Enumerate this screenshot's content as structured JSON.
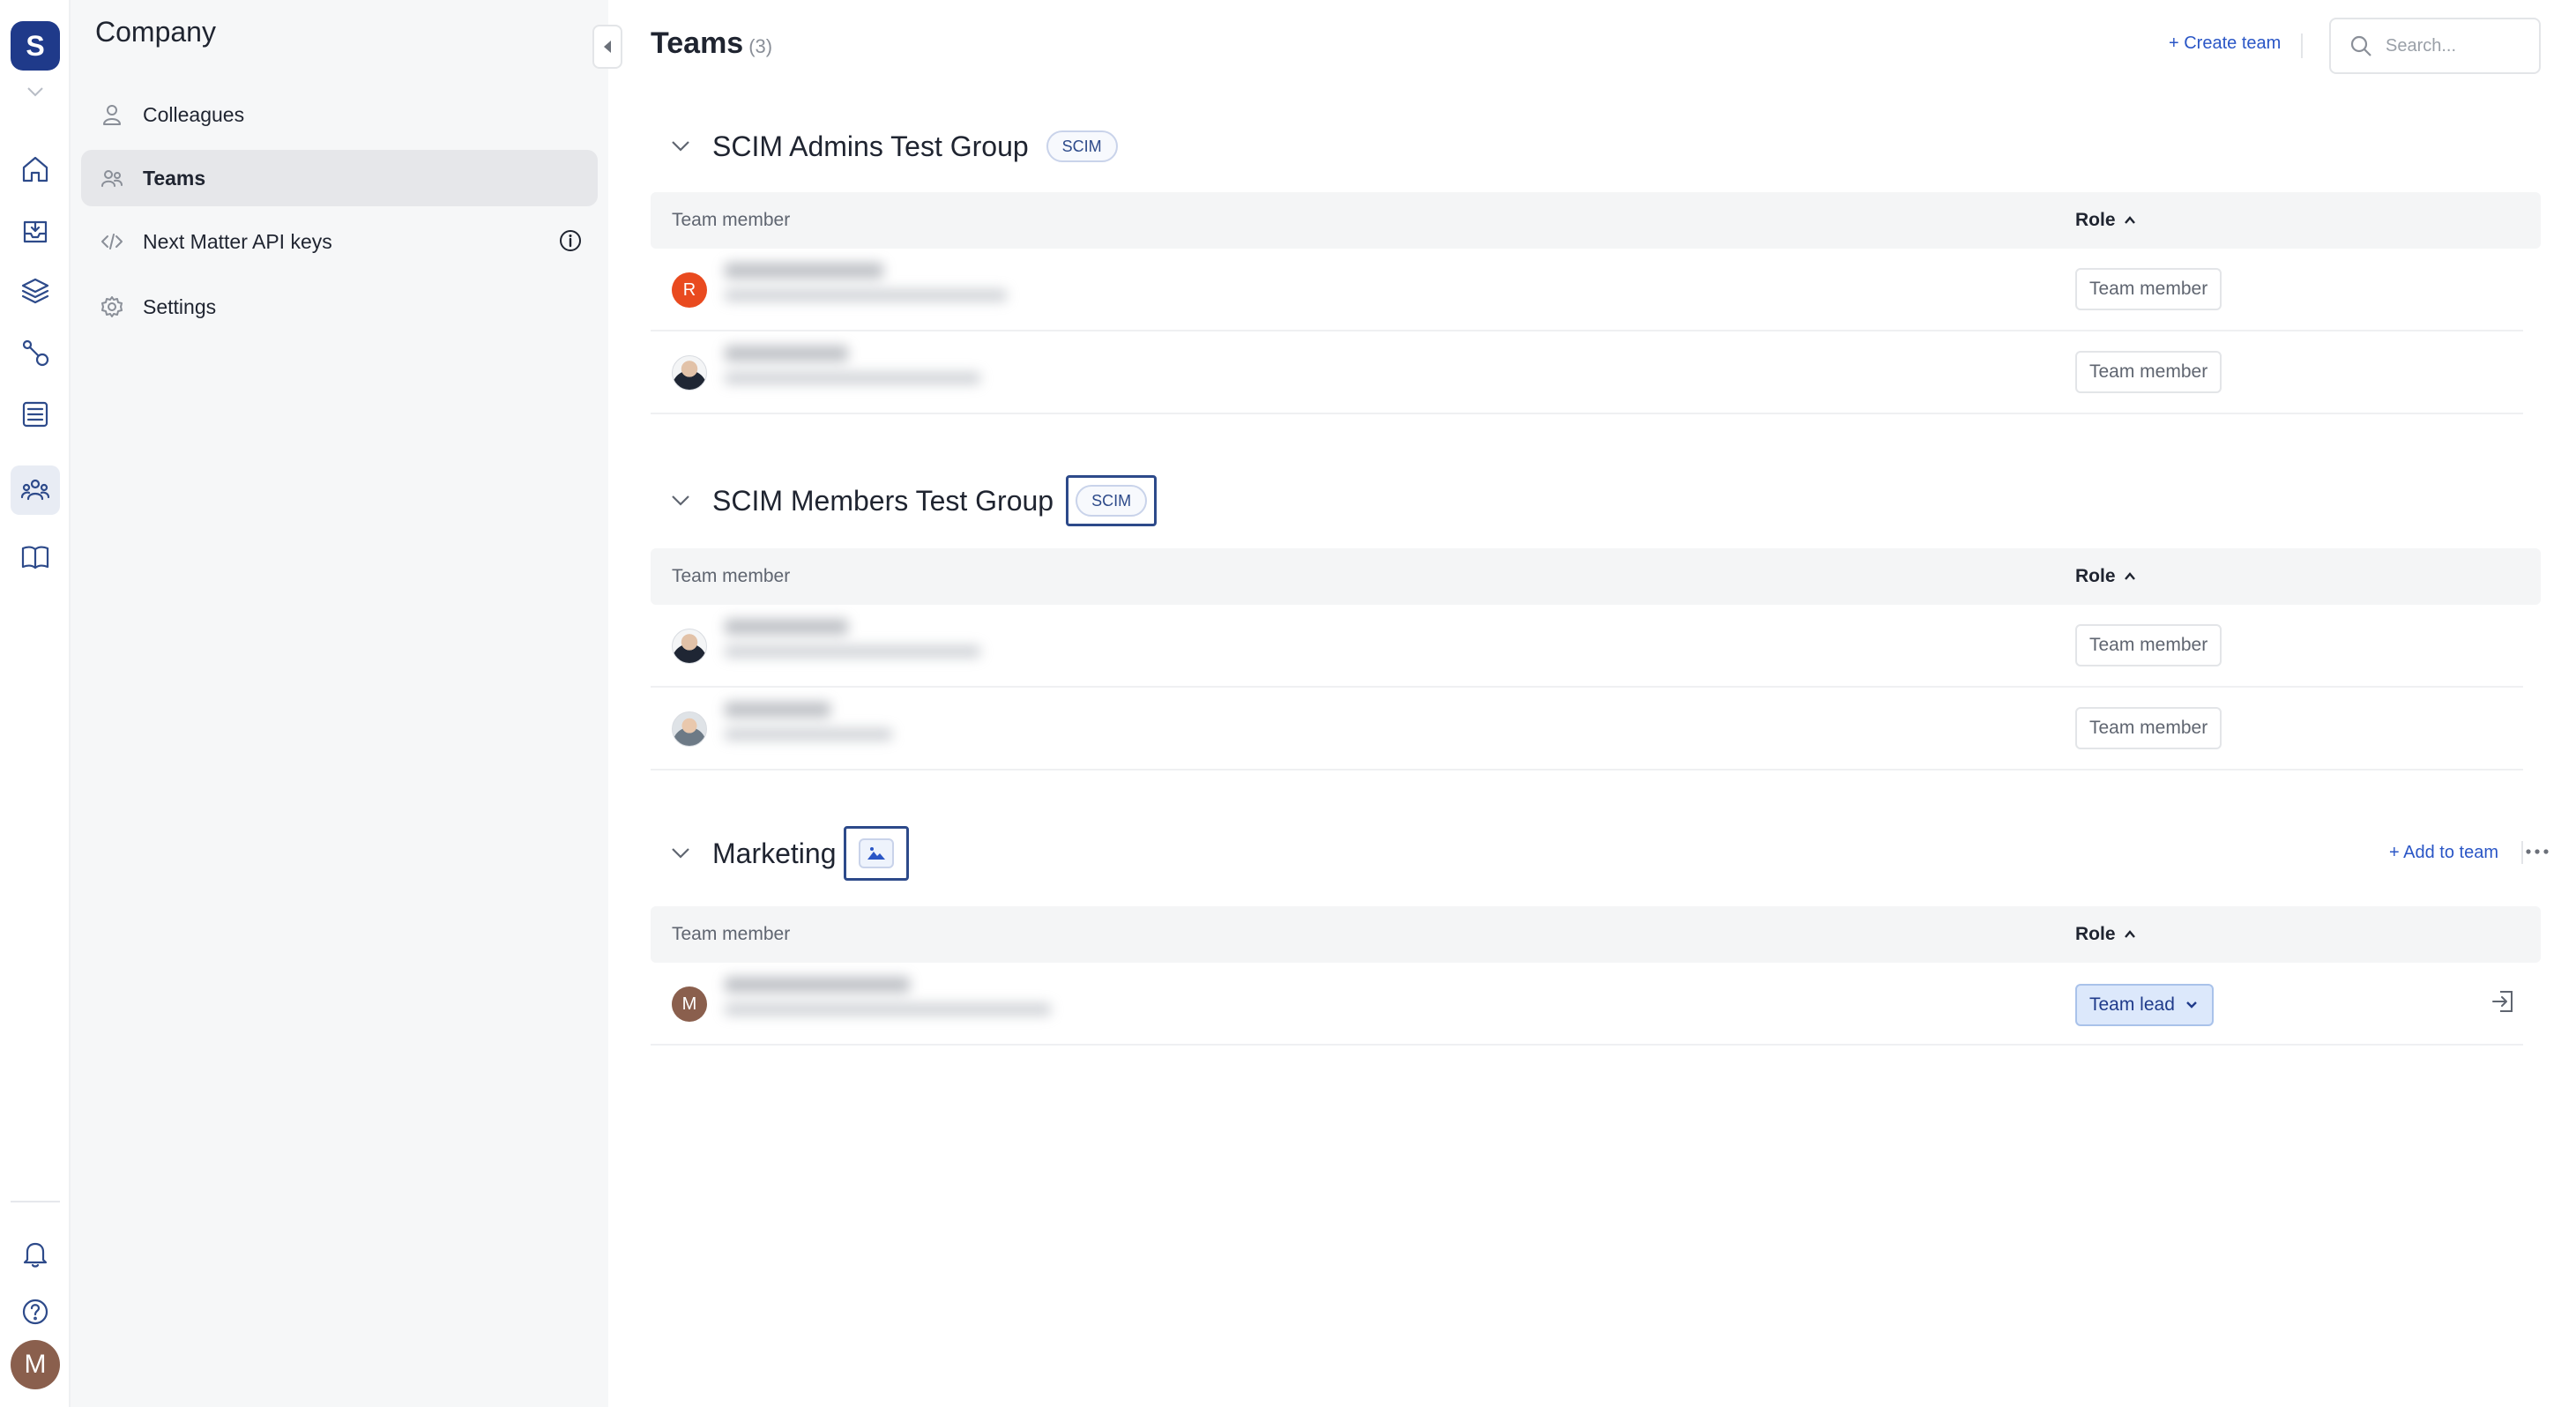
{
  "workspace": {
    "initial": "S"
  },
  "user": {
    "initial": "M"
  },
  "subnav": {
    "title": "Company",
    "items": [
      {
        "label": "Colleagues",
        "icon": "user-icon"
      },
      {
        "label": "Teams",
        "icon": "users-icon",
        "active": true
      },
      {
        "label": "Next Matter API keys",
        "icon": "code-icon"
      },
      {
        "label": "Settings",
        "icon": "gear-icon"
      }
    ]
  },
  "header": {
    "title": "Teams",
    "count": "(3)",
    "create_label": "+ Create team",
    "search_placeholder": "Search..."
  },
  "table_headers": {
    "member": "Team member",
    "role": "Role"
  },
  "teams": [
    {
      "name": "SCIM Admins Test Group",
      "badge": "SCIM",
      "members": [
        {
          "initial": "R",
          "avatar": "red",
          "role": "Team member"
        },
        {
          "initial": "",
          "avatar": "photo",
          "role": "Team member"
        }
      ]
    },
    {
      "name": "SCIM Members Test Group",
      "badge": "SCIM",
      "members": [
        {
          "initial": "",
          "avatar": "photo",
          "role": "Team member"
        },
        {
          "initial": "",
          "avatar": "photo",
          "role": "Team member"
        }
      ]
    },
    {
      "name": "Marketing",
      "badge_icon": "image-icon",
      "add_label": "+ Add to team",
      "members": [
        {
          "initial": "M",
          "avatar": "brown",
          "role": "Team lead"
        }
      ]
    }
  ],
  "colors": {
    "accent": "#2a56c6",
    "brand": "#1f3a8a",
    "highlight_frame": "#2d4a8a"
  }
}
